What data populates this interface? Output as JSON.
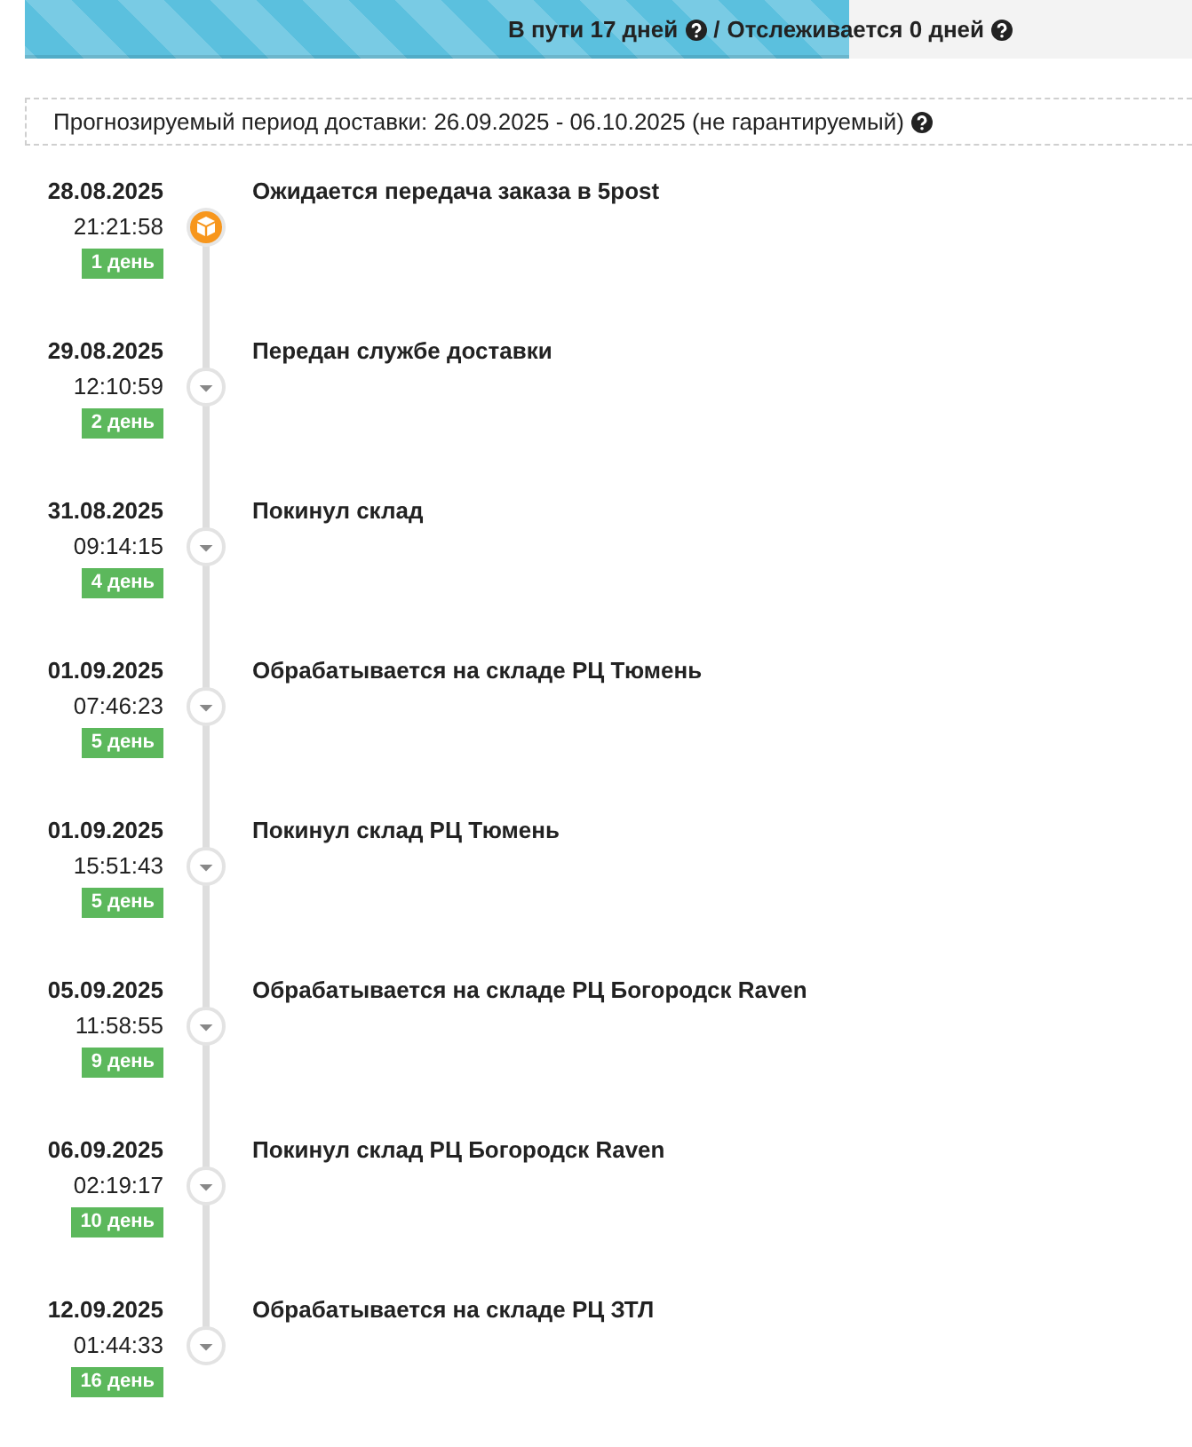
{
  "progress": {
    "in_transit": "В пути 17 дней",
    "separator": "/",
    "tracked": "Отслеживается 0 дней",
    "level": 0.706
  },
  "forecast": {
    "text": "Прогнозируемый период доставки: 26.09.2025 - 06.10.2025 (не гарантируемый)"
  },
  "events": [
    {
      "date": "28.08.2025",
      "time": "21:21:58",
      "day": "1 день",
      "title": "Ожидается передача заказа в 5post",
      "kind": "current"
    },
    {
      "date": "29.08.2025",
      "time": "12:10:59",
      "day": "2 день",
      "title": "Передан службе доставки",
      "kind": "passed"
    },
    {
      "date": "31.08.2025",
      "time": "09:14:15",
      "day": "4 день",
      "title": "Покинул склад",
      "kind": "passed"
    },
    {
      "date": "01.09.2025",
      "time": "07:46:23",
      "day": "5 день",
      "title": "Обрабатывается на складе РЦ Тюмень",
      "kind": "passed"
    },
    {
      "date": "01.09.2025",
      "time": "15:51:43",
      "day": "5 день",
      "title": "Покинул склад РЦ Тюмень",
      "kind": "passed"
    },
    {
      "date": "05.09.2025",
      "time": "11:58:55",
      "day": "9 день",
      "title": "Обрабатывается на складе РЦ Богородск Raven",
      "kind": "passed"
    },
    {
      "date": "06.09.2025",
      "time": "02:19:17",
      "day": "10 день",
      "title": "Покинул склад РЦ Богородск Raven",
      "kind": "passed"
    },
    {
      "date": "12.09.2025",
      "time": "01:44:33",
      "day": "16 день",
      "title": "Обрабатывается на складе РЦ ЗТЛ",
      "kind": "passed"
    }
  ]
}
